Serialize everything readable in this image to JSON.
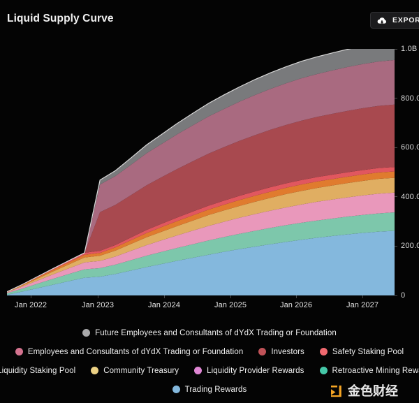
{
  "header": {
    "title": "Liquid Supply Curve",
    "export_label": "EXPORT C",
    "export_icon": "cloud-download-icon"
  },
  "watermark": {
    "text": "金色财经",
    "accent_color": "#f5a524"
  },
  "chart_data": {
    "type": "area",
    "title": "Liquid Supply Curve",
    "xlabel": "",
    "ylabel": "",
    "stacked": true,
    "grid": false,
    "legend_position": "bottom",
    "xlim": [
      "2021-09-01",
      "2027-08-01"
    ],
    "ylim": [
      0,
      1000000000
    ],
    "x_ticks": [
      "Jan 2022",
      "Jan 2023",
      "Jan 2024",
      "Jan 2025",
      "Jan 2026",
      "Jan 2027"
    ],
    "y_ticks": [
      "0",
      "200.0",
      "400.0",
      "600.0",
      "800.0",
      "1.0B"
    ],
    "y_tick_values": [
      0,
      200000000,
      400000000,
      600000000,
      800000000,
      1000000000
    ],
    "x": [
      "2021-09",
      "2021-12",
      "2022-03",
      "2022-06",
      "2022-09",
      "2022-12",
      "2023-01",
      "2023-03",
      "2023-06",
      "2023-09",
      "2023-12",
      "2024-03",
      "2024-06",
      "2024-09",
      "2024-12",
      "2025-03",
      "2025-06",
      "2025-09",
      "2025-12",
      "2026-03",
      "2026-06",
      "2026-09",
      "2026-12",
      "2027-03",
      "2027-06",
      "2027-08"
    ],
    "series": [
      {
        "name": "Trading Rewards",
        "color": "#84b8dd",
        "values": [
          3000000,
          16000000,
          30000000,
          44000000,
          58000000,
          72000000,
          76000000,
          87000000,
          101000000,
          115000000,
          128000000,
          141000000,
          153000000,
          165000000,
          177000000,
          188000000,
          198000000,
          208000000,
          217000000,
          226000000,
          234000000,
          241000000,
          248000000,
          254000000,
          259000000,
          262000000
        ]
      },
      {
        "name": "Retroactive Mining Rewards",
        "color": "#7dc7ab",
        "values": [
          6000000,
          12000000,
          18000000,
          24000000,
          29000000,
          34000000,
          35000000,
          38000000,
          42000000,
          46000000,
          49000000,
          52000000,
          55000000,
          58000000,
          60000000,
          62000000,
          64000000,
          66000000,
          68000000,
          69000000,
          70000000,
          71000000,
          72000000,
          73000000,
          74000000,
          75000000
        ]
      },
      {
        "name": "Liquidity Provider Rewards",
        "color": "#e998bb",
        "values": [
          3000000,
          8000000,
          13000000,
          18000000,
          23000000,
          28000000,
          29000000,
          33000000,
          38000000,
          43000000,
          47000000,
          51000000,
          55000000,
          59000000,
          62000000,
          65000000,
          68000000,
          70000000,
          72000000,
          74000000,
          76000000,
          77000000,
          78000000,
          79000000,
          80000000,
          80000000
        ]
      },
      {
        "name": "Community Treasury",
        "color": "#e0ae62",
        "values": [
          1000000,
          4000000,
          8000000,
          12000000,
          16000000,
          20000000,
          21000000,
          24000000,
          28000000,
          32000000,
          35000000,
          38000000,
          41000000,
          44000000,
          46000000,
          48000000,
          50000000,
          52000000,
          54000000,
          55000000,
          56000000,
          57000000,
          58000000,
          59000000,
          60000000,
          60000000
        ]
      },
      {
        "name": "Liquidity Staking Pool",
        "color": "#e07b2e",
        "values": [
          1000000,
          3000000,
          5000000,
          7000000,
          9000000,
          11000000,
          11500000,
          13000000,
          15000000,
          17000000,
          19000000,
          20000000,
          21000000,
          22000000,
          23000000,
          24000000,
          24500000,
          25000000,
          25500000,
          26000000,
          26000000,
          26000000,
          26000000,
          26000000,
          26000000,
          26000000
        ]
      },
      {
        "name": "Safety Staking Pool",
        "color": "#e1575f",
        "values": [
          1000000,
          2000000,
          3500000,
          5000000,
          6500000,
          8000000,
          8500000,
          9500000,
          11000000,
          12500000,
          13500000,
          14500000,
          15500000,
          16000000,
          16500000,
          17000000,
          17500000,
          18000000,
          18000000,
          18000000,
          18000000,
          18000000,
          18000000,
          18000000,
          18000000,
          18000000
        ]
      },
      {
        "name": "Investors",
        "color": "#a8494f",
        "values": [
          0,
          0,
          0,
          0,
          0,
          0,
          157000000,
          163000000,
          172000000,
          181000000,
          189000000,
          197000000,
          204000000,
          211000000,
          217000000,
          223000000,
          228000000,
          233000000,
          237000000,
          241000000,
          244000000,
          247000000,
          249000000,
          251000000,
          252000000,
          253000000
        ]
      },
      {
        "name": "Employees and Consultants of dYdX Trading or Foundation",
        "color": "#a96a80",
        "values": [
          0,
          0,
          0,
          0,
          0,
          0,
          112000000,
          117000000,
          123000000,
          130000000,
          135000000,
          141000000,
          146000000,
          151000000,
          155000000,
          159000000,
          163000000,
          166000000,
          169000000,
          172000000,
          174000000,
          176000000,
          178000000,
          179000000,
          180000000,
          181000000
        ]
      },
      {
        "name": "Future Employees and Consultants of dYdX Trading or Foundation",
        "color": "#797a7c",
        "values": [
          0,
          0,
          0,
          0,
          0,
          0,
          18000000,
          22000000,
          28000000,
          34000000,
          39000000,
          44000000,
          49000000,
          53000000,
          57000000,
          60000000,
          63000000,
          65000000,
          67000000,
          69000000,
          70000000,
          71000000,
          72000000,
          73000000,
          74000000,
          75000000
        ]
      }
    ]
  },
  "legend": {
    "rows": [
      [
        {
          "label": "Future Employees and Consultants of dYdX Trading or Foundation",
          "color": "#a9a9ab"
        }
      ],
      [
        {
          "label": "Employees and Consultants of dYdX Trading or Foundation",
          "color": "#d4738f"
        },
        {
          "label": "Investors",
          "color": "#c05258"
        },
        {
          "label": "Safety Staking Pool",
          "color": "#f0696f"
        }
      ],
      [
        {
          "label": "Liquidity Staking Pool",
          "color": "#e07b2e"
        },
        {
          "label": "Community Treasury",
          "color": "#ecd184"
        },
        {
          "label": "Liquidity Provider Rewards",
          "color": "#df86d4"
        },
        {
          "label": "Retroactive Mining Rewards",
          "color": "#45c8a8"
        }
      ],
      [
        {
          "label": "Trading Rewards",
          "color": "#84b8dd"
        }
      ]
    ]
  }
}
